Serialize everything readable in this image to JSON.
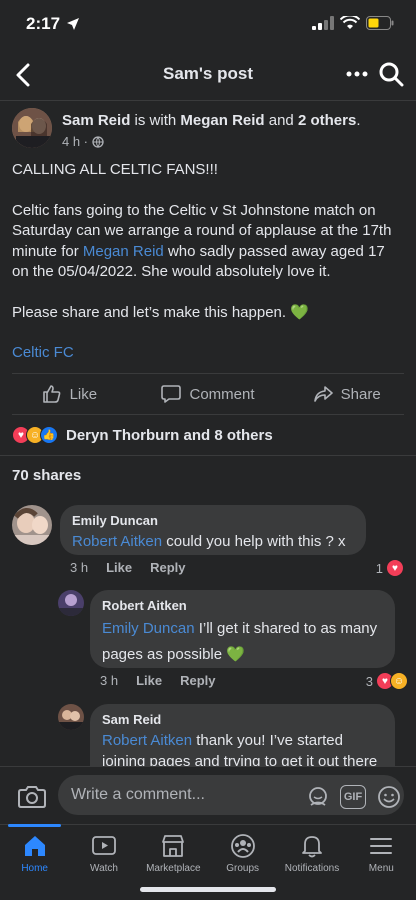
{
  "status": {
    "time": "2:17"
  },
  "header": {
    "title": "Sam's post"
  },
  "post": {
    "author": "Sam Reid",
    "with_text": "is with",
    "with_name": "Megan Reid",
    "and_text": "and",
    "others": "2 others",
    "time": "4 h ·",
    "line1": "CALLING ALL CELTIC FANS!!!",
    "para_a": "Celtic fans going to the Celtic v St Johnstone match on Saturday can we arrange a round of applause at the 17th minute for",
    "para_link": "Megan Reid",
    "para_b": "who sadly passed away aged 17 on the 05/04/2022. She would absolutely love it.",
    "line3": "Please share and let’s make this happen.",
    "line3_emoji": "💚",
    "tag": "Celtic FC"
  },
  "actions": {
    "like": "Like",
    "comment": "Comment",
    "share": "Share"
  },
  "reactions": {
    "text": "Deryn Thorburn and 8 others"
  },
  "shares": "70 shares",
  "comments": [
    {
      "name": "Emily Duncan",
      "mention": "Robert Aitken",
      "text": "could you help with this ? x",
      "time": "3 h",
      "like": "Like",
      "reply": "Reply",
      "count": "1"
    },
    {
      "name": "Robert Aitken",
      "mention": "Emily Duncan",
      "text": "I’ll get it shared to as many pages as possible",
      "emoji": "💚",
      "time": "3 h",
      "like": "Like",
      "reply": "Reply",
      "count": "3"
    },
    {
      "name": "Sam Reid",
      "mention": "Robert Aitken",
      "text": "thank you! I’ve started joining pages and trying to get it out there"
    }
  ],
  "composer": {
    "placeholder": "Write a comment...",
    "gif": "GIF"
  },
  "tabs": [
    {
      "label": "Home",
      "icon": "home-icon"
    },
    {
      "label": "Watch",
      "icon": "watch-icon"
    },
    {
      "label": "Marketplace",
      "icon": "marketplace-icon"
    },
    {
      "label": "Groups",
      "icon": "groups-icon"
    },
    {
      "label": "Notifications",
      "icon": "bell-icon"
    },
    {
      "label": "Menu",
      "icon": "menu-icon"
    }
  ],
  "colors": {
    "background": "#242526",
    "link": "#4a8ad4",
    "accent": "#2d88ff",
    "bubble": "#3a3b3c"
  }
}
